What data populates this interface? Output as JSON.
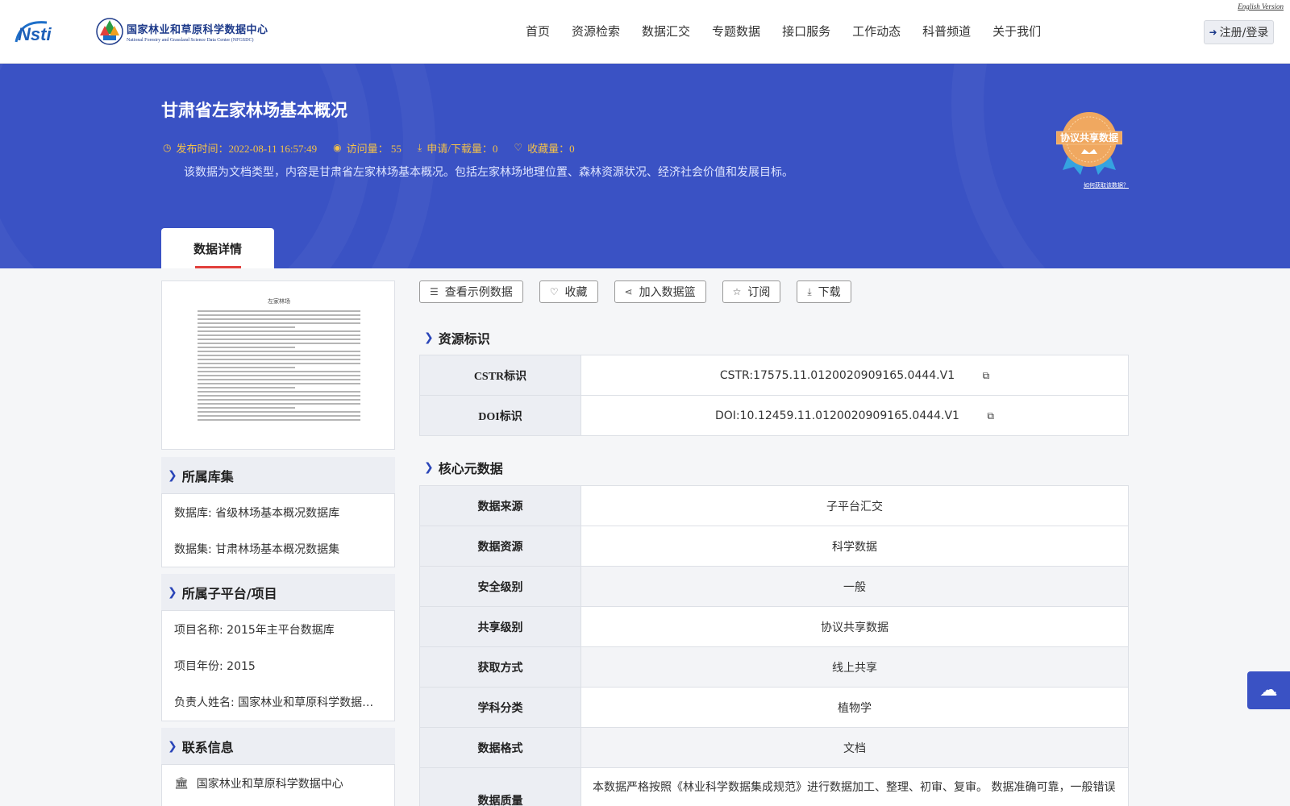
{
  "header": {
    "logo_left": "NSTI",
    "logo_cn": "国家林业和草原科学数据中心",
    "logo_en": "National Forestry and Grassland Science Data Center (NFGSDC)",
    "english_link": "English Version",
    "nav": [
      "首页",
      "资源检索",
      "数据汇交",
      "专题数据",
      "接口服务",
      "工作动态",
      "科普频道",
      "关于我们"
    ],
    "login_label": "注册/登录"
  },
  "banner": {
    "title": "甘肃省左家林场基本概况",
    "publish": "发布时间：2022-08-11 16:57:49",
    "visits": "访问量： 55",
    "downloads": "申请/下载量：0",
    "favorites": "收藏量：0",
    "description": "该数据为文档类型，内容是甘肃省左家林场基本概况。包括左家林场地理位置、森林资源状况、经济社会价值和发展目标。",
    "badge_text": "协议共享数据",
    "badge_link": "如何获取该数据？",
    "tab_label": "数据详情"
  },
  "thumbnail": {
    "doc_title": "左家林场"
  },
  "collection": {
    "heading": "所属库集",
    "database": "数据库: 省级林场基本概况数据库",
    "dataset": "数据集: 甘肃林场基本概况数据集"
  },
  "project": {
    "heading": "所属子平台/项目",
    "name": "项目名称: 2015年主平台数据库",
    "year": "项目年份: 2015",
    "owner": "负责人姓名: 国家林业和草原科学数据中心"
  },
  "contact": {
    "heading": "联系信息",
    "org": "国家林业和草原科学数据中心"
  },
  "actions": [
    "查看示例数据",
    "收藏",
    "加入数据篮",
    "订阅",
    "下载"
  ],
  "identifiers": {
    "heading": "资源标识",
    "rows": [
      {
        "k": "CSTR标识",
        "v": "CSTR:17575.11.0120020909165.0444.V1"
      },
      {
        "k": "DOI标识",
        "v": "DOI:10.12459.11.0120020909165.0444.V1"
      }
    ]
  },
  "core": {
    "heading": "核心元数据",
    "rows": [
      {
        "k": "数据来源",
        "v": "子平台汇交"
      },
      {
        "k": "数据资源",
        "v": "科学数据"
      },
      {
        "k": "安全级别",
        "v": "一般"
      },
      {
        "k": "共享级别",
        "v": "协议共享数据"
      },
      {
        "k": "获取方式",
        "v": "线上共享"
      },
      {
        "k": "学科分类",
        "v": "植物学"
      },
      {
        "k": "数据格式",
        "v": "文档"
      },
      {
        "k": "数据质量",
        "v": "本数据严格按照《林业科学数据集成规范》进行数据加工、整理、初审、复审。 数据准确可靠，一般错误"
      }
    ]
  }
}
